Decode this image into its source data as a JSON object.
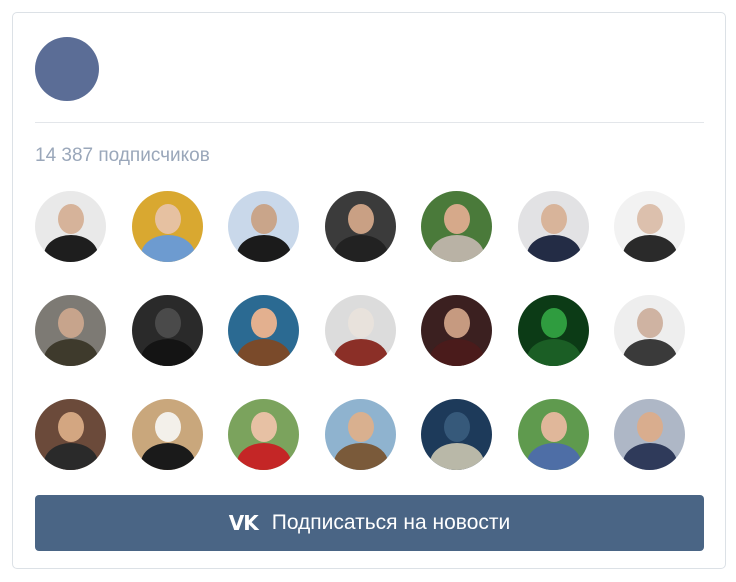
{
  "community": {
    "subscribers_text": "14 387 подписчиков"
  },
  "followers": {
    "rows": [
      [
        {
          "bg": "#e9e9e9",
          "skin": "#d6b39a",
          "cloth": "#1e1e1e",
          "icon": "person-photo"
        },
        {
          "bg": "#d9a830",
          "skin": "#e6c1a1",
          "cloth": "#6d9bd0",
          "icon": "person-photo"
        },
        {
          "bg": "#c9d8ea",
          "skin": "#c9a58a",
          "cloth": "#1b1b1b",
          "icon": "person-photo"
        },
        {
          "bg": "#3b3b3b",
          "skin": "#c9a084",
          "cloth": "#222222",
          "icon": "person-photo"
        },
        {
          "bg": "#4a7a3a",
          "skin": "#d6a98a",
          "cloth": "#b9b2a5",
          "icon": "person-photo"
        },
        {
          "bg": "#e2e2e4",
          "skin": "#d8b49a",
          "cloth": "#232c45",
          "icon": "person-photo"
        },
        {
          "bg": "#f2f2f2",
          "skin": "#dcc0ad",
          "cloth": "#2a2a2a",
          "icon": "person-photo"
        }
      ],
      [
        {
          "bg": "#7d7a74",
          "skin": "#c7a48c",
          "cloth": "#3e3a2c",
          "icon": "person-photo"
        },
        {
          "bg": "#2a2a2a",
          "skin": "#4a4a4a",
          "cloth": "#141414",
          "icon": "person-photo"
        },
        {
          "bg": "#2b6a92",
          "skin": "#e3b08f",
          "cloth": "#7a4a2a",
          "icon": "person-photo"
        },
        {
          "bg": "#dcdcdc",
          "skin": "#e8e2dc",
          "cloth": "#8b2f27",
          "icon": "person-photo"
        },
        {
          "bg": "#3b2020",
          "skin": "#c69a80",
          "cloth": "#4a1b1b",
          "icon": "person-photo"
        },
        {
          "bg": "#0c3b16",
          "skin": "#2f9c3f",
          "cloth": "#1b5e25",
          "icon": "person-photo"
        },
        {
          "bg": "#eeeeee",
          "skin": "#cfb3a2",
          "cloth": "#3a3a3a",
          "icon": "person-photo"
        }
      ],
      [
        {
          "bg": "#6b4a3a",
          "skin": "#d3a681",
          "cloth": "#2a2a2a",
          "icon": "person-photo"
        },
        {
          "bg": "#c9a77c",
          "skin": "#f3f0ea",
          "cloth": "#1a1a1a",
          "icon": "person-photo"
        },
        {
          "bg": "#7ba35d",
          "skin": "#e7c1a4",
          "cloth": "#c42626",
          "icon": "person-photo"
        },
        {
          "bg": "#8fb3cf",
          "skin": "#d9b08f",
          "cloth": "#7a5a3a",
          "icon": "person-photo"
        },
        {
          "bg": "#1d3a5a",
          "skin": "#36597a",
          "cloth": "#b9b8a8",
          "icon": "person-photo"
        },
        {
          "bg": "#5f9a4e",
          "skin": "#e0b79a",
          "cloth": "#4e6ea6",
          "icon": "person-photo"
        },
        {
          "bg": "#aeb7c6",
          "skin": "#d9ad8e",
          "cloth": "#2f3a5a",
          "icon": "person-photo"
        }
      ]
    ]
  },
  "subscribe": {
    "logo_text": "VK",
    "label": "Подписаться на новости",
    "color": "#4a6585"
  },
  "group_avatar_color": "#5b6d96"
}
